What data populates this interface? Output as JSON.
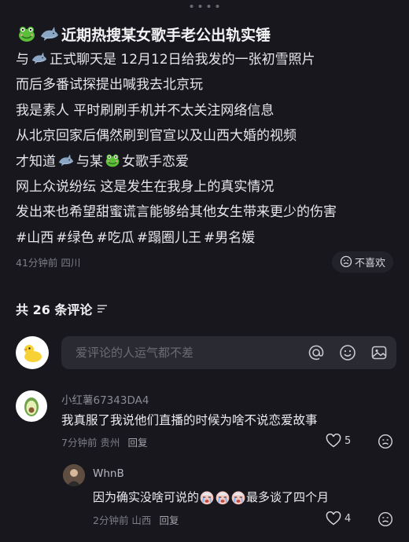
{
  "post": {
    "title_text": "近期热搜某女歌手老公出轨实锤",
    "line1_a": "与",
    "line1_b": "正式聊天是 12月12日给我发的一张初雪照片",
    "line2": "而后多番试探提出喊我去北京玩",
    "line3": "我是素人 平时刷刷手机并不太关注网络信息",
    "line4": "从北京回家后偶然刷到官宣以及山西大婚的视频",
    "line5_a": "才知道",
    "line5_b": "与某",
    "line5_c": "女歌手恋爱",
    "line6": "网上众说纷纭 这是发生在我身上的真实情况",
    "line7": "发出来也希望甜蜜谎言能够给其他女生带来更少的伤害",
    "tags": [
      "#山西",
      "#绿色",
      "#吃瓜",
      "#蹋圈儿王",
      "#男名媛"
    ],
    "meta": "41分钟前 四川",
    "dislike_label": "不喜欢"
  },
  "comments_header": {
    "count_label": "共 26 条评论"
  },
  "comment_input": {
    "placeholder": "爱评论的人运气都不差"
  },
  "comments": [
    {
      "author": "小红薯67343DA4",
      "text": "我真服了我说他们直播的时候为啥不说恋爱故事",
      "time_loc": "7分钟前 贵州",
      "reply_label": "回复",
      "likes": "5"
    }
  ],
  "replies": [
    {
      "author": "WhnB",
      "text_a": "因为确实没啥可说的",
      "text_b": "最多谈了四个月",
      "time_loc": "2分钟前 山西",
      "reply_label": "回复",
      "likes": "4"
    }
  ],
  "icons": {
    "frog": "frog-emoji-icon",
    "shark": "shark-emoji-icon",
    "duck": "duck-avatar-icon",
    "avocado": "avocado-avatar-icon",
    "crying": "crying-emoji-icon",
    "at": "at-icon",
    "emoji": "emoji-icon",
    "image": "image-icon",
    "heart": "heart-icon",
    "sad": "sad-face-icon",
    "sort": "sort-icon"
  },
  "colors": {
    "background": "#17171d",
    "input_bg": "#2a2a32",
    "muted": "#7d7d86",
    "frog": "#5cbf3a",
    "shark": "#8aa6c4"
  }
}
